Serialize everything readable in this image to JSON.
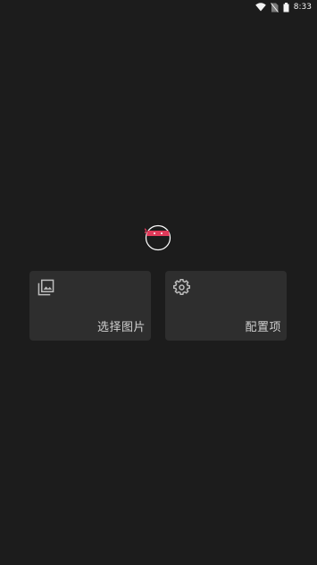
{
  "status_bar": {
    "time": "8:33",
    "icons": [
      "wifi-icon",
      "no-sim-icon",
      "battery-icon"
    ]
  },
  "logo": {
    "icon": "ninja-logo-icon",
    "colors": {
      "mask": "#e03a5a",
      "eyes": "#ffffff",
      "outline": "#ffffff"
    }
  },
  "cards": [
    {
      "label": "选择图片",
      "icon": "gallery-icon"
    },
    {
      "label": "配置项",
      "icon": "gear-icon"
    }
  ],
  "colors": {
    "background": "#1c1c1c",
    "card": "#2e2e2e",
    "text": "#cfcfcf"
  }
}
